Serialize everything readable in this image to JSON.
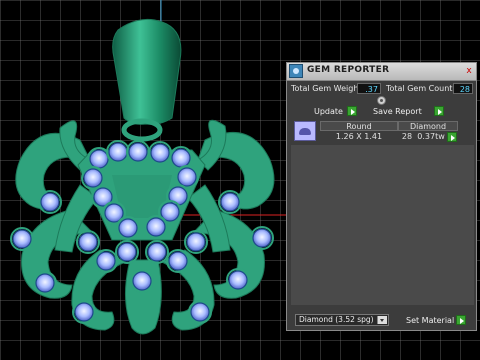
{
  "panel": {
    "title": "GEM REPORTER",
    "close_label": "x",
    "total_gem_weight_label": "Total Gem Weight",
    "total_gem_weight_value": ".37",
    "total_gem_count_label": "Total Gem Count",
    "total_gem_count_value": "28",
    "update_label": "Update",
    "save_report_label": "Save Report",
    "table": {
      "headers": [
        "Round",
        "Diamond"
      ],
      "row": {
        "size": "1.26 X 1.41",
        "count": "28",
        "weight": "0.37tw"
      }
    },
    "material_select": "Diamond    (3.52 spg)",
    "set_material_label": "Set Material"
  },
  "colors": {
    "model_green": "#2fa37d",
    "gem_blue": "#8ea8ff",
    "grid_white": "#ffffff",
    "panel_bg": "#3c3c3c",
    "value_cyan": "#5fd8ff",
    "arrow_green": "#3aa632"
  }
}
